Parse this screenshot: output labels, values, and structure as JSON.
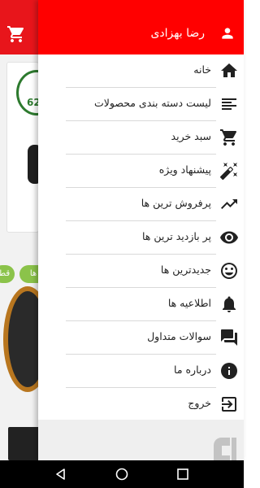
{
  "user": {
    "name": "رضا بهزادی"
  },
  "menu": {
    "items": [
      {
        "label": "خانه",
        "icon": "home-icon"
      },
      {
        "label": "لیست دسته بندی محصولات",
        "icon": "list-icon"
      },
      {
        "label": "سبد خرید",
        "icon": "cart-icon"
      },
      {
        "label": "پیشنهاد ویژه",
        "icon": "magic-wand-icon"
      },
      {
        "label": "پرفروش ترین ها",
        "icon": "trending-up-icon"
      },
      {
        "label": "پر بازدید ترین ها",
        "icon": "eye-icon"
      },
      {
        "label": "جدیدترین ها",
        "icon": "smiley-icon"
      },
      {
        "label": "اطلاعیه ها",
        "icon": "bell-icon"
      },
      {
        "label": "سوالات متداول",
        "icon": "chat-icon"
      },
      {
        "label": "درباره ما",
        "icon": "info-icon"
      },
      {
        "label": "خروج",
        "icon": "logout-icon"
      }
    ]
  },
  "background": {
    "logo_text": "62",
    "chips": [
      "ها",
      "قط"
    ]
  },
  "colors": {
    "header": "#ff0000",
    "appbar": "#e8151b",
    "icon": "#212121"
  }
}
